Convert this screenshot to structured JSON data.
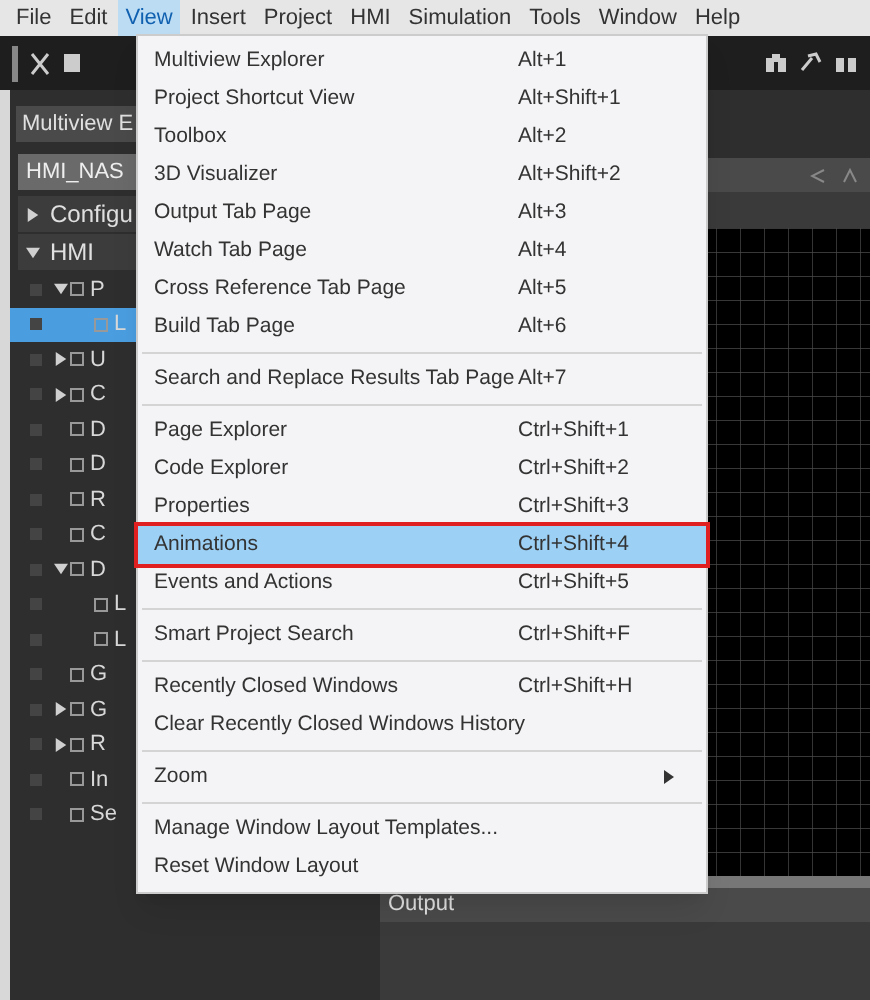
{
  "menu_bar": [
    {
      "label": "File",
      "selected": false
    },
    {
      "label": "Edit",
      "selected": false
    },
    {
      "label": "View",
      "selected": true
    },
    {
      "label": "Insert",
      "selected": false
    },
    {
      "label": "Project",
      "selected": false
    },
    {
      "label": "HMI",
      "selected": false
    },
    {
      "label": "Simulation",
      "selected": false
    },
    {
      "label": "Tools",
      "selected": false
    },
    {
      "label": "Window",
      "selected": false
    },
    {
      "label": "Help",
      "selected": false
    }
  ],
  "left_panel": {
    "title": "Multiview E",
    "selector": "HMI_NAS",
    "tree": [
      {
        "label": "Configu",
        "expanded": false
      },
      {
        "label": "HMI",
        "expanded": true,
        "children": [
          {
            "label": "P",
            "expanded": true,
            "children": [
              {
                "label": "L",
                "selected": true
              }
            ]
          },
          {
            "label": "U",
            "expanded": false
          },
          {
            "label": "C",
            "expanded": false
          },
          {
            "label": "D"
          },
          {
            "label": "D"
          },
          {
            "label": "R"
          },
          {
            "label": "C"
          },
          {
            "label": "D",
            "expanded": true,
            "children": [
              {
                "label": "L",
                "selected": false
              },
              {
                "label": "L",
                "selected": false
              }
            ]
          },
          {
            "label": "G"
          },
          {
            "label": "G",
            "expanded": false
          },
          {
            "label": "R",
            "expanded": false
          },
          {
            "label": "In"
          },
          {
            "label": "Se"
          }
        ]
      }
    ]
  },
  "view_menu": [
    {
      "kind": "item",
      "label": "Multiview Explorer",
      "shortcut": "Alt+1",
      "selected": false
    },
    {
      "kind": "item",
      "label": "Project Shortcut View",
      "shortcut": "Alt+Shift+1",
      "selected": false
    },
    {
      "kind": "item",
      "label": "Toolbox",
      "shortcut": "Alt+2",
      "selected": false
    },
    {
      "kind": "item",
      "label": "3D Visualizer",
      "shortcut": "Alt+Shift+2",
      "selected": false
    },
    {
      "kind": "item",
      "label": "Output Tab Page",
      "shortcut": "Alt+3",
      "selected": false
    },
    {
      "kind": "item",
      "label": "Watch Tab Page",
      "shortcut": "Alt+4",
      "selected": false
    },
    {
      "kind": "item",
      "label": "Cross Reference Tab Page",
      "shortcut": "Alt+5",
      "selected": false
    },
    {
      "kind": "item",
      "label": "Build Tab Page",
      "shortcut": "Alt+6",
      "selected": false
    },
    {
      "kind": "separator"
    },
    {
      "kind": "item",
      "label": "Search and Replace Results Tab Page",
      "shortcut": "Alt+7",
      "selected": false
    },
    {
      "kind": "separator"
    },
    {
      "kind": "item",
      "label": "Page Explorer",
      "shortcut": "Ctrl+Shift+1",
      "selected": false
    },
    {
      "kind": "item",
      "label": "Code Explorer",
      "shortcut": "Ctrl+Shift+2",
      "selected": false
    },
    {
      "kind": "item",
      "label": "Properties",
      "shortcut": "Ctrl+Shift+3",
      "selected": false
    },
    {
      "kind": "item",
      "label": "Animations",
      "shortcut": "Ctrl+Shift+4",
      "selected": true
    },
    {
      "kind": "item",
      "label": "Events and Actions",
      "shortcut": "Ctrl+Shift+5",
      "selected": false
    },
    {
      "kind": "separator"
    },
    {
      "kind": "item",
      "label": "Smart Project Search",
      "shortcut": "Ctrl+Shift+F",
      "selected": false
    },
    {
      "kind": "separator"
    },
    {
      "kind": "item",
      "label": "Recently Closed Windows",
      "shortcut": "Ctrl+Shift+H",
      "selected": false
    },
    {
      "kind": "item",
      "label": "Clear Recently Closed Windows History",
      "selected": false
    },
    {
      "kind": "separator"
    },
    {
      "kind": "submenu",
      "label": "Zoom",
      "selected": false
    },
    {
      "kind": "separator"
    },
    {
      "kind": "item",
      "label": "Manage Window Layout Templates...",
      "selected": false
    },
    {
      "kind": "item",
      "label": "Reset Window Layout",
      "selected": false
    }
  ],
  "output_panel": {
    "title": "Output"
  }
}
